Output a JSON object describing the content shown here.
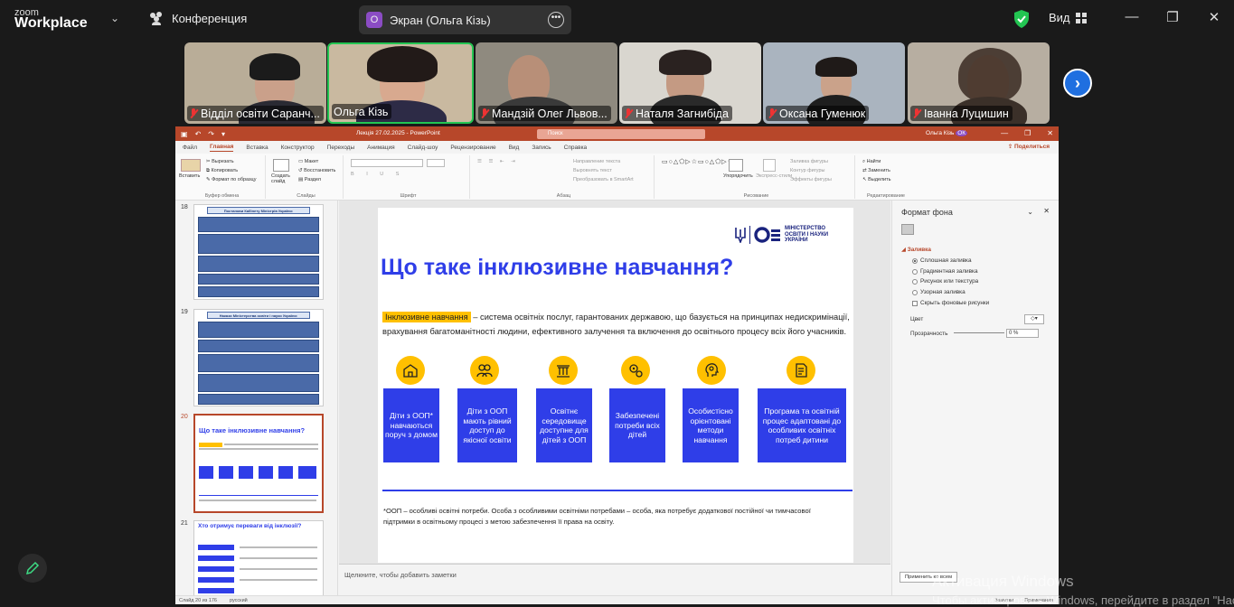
{
  "zoom": {
    "logo_line1": "zoom",
    "logo_line2": "Workplace",
    "conference_label": "Конференция",
    "share_initial": "О",
    "share_label": "Экран (Ольга Кізь)",
    "view_label": "Вид",
    "win_min": "—",
    "win_max": "❐",
    "win_close": "✕",
    "next_arrow": "›",
    "accent": "#1f6fe0",
    "security_color": "#23c552"
  },
  "participants": [
    {
      "name": "Відділ освіти Саранч...",
      "muted": true
    },
    {
      "name": "Ольга Кізь",
      "muted": false,
      "active": true
    },
    {
      "name": "Мандзій Олег Львов...",
      "muted": true
    },
    {
      "name": "Наталя Загнибіда",
      "muted": true
    },
    {
      "name": "Оксана Гуменюк",
      "muted": true
    },
    {
      "name": "Іванна Луцишин",
      "muted": true
    }
  ],
  "ppt": {
    "file_title": "Лекція 27.02.2025 - PowerPoint",
    "search_placeholder": "Поиск",
    "user_name": "Ольга Кізь",
    "user_initials": "ОК",
    "share_label": "Поделиться",
    "menu": [
      "Файл",
      "Главная",
      "Вставка",
      "Конструктор",
      "Переходы",
      "Анимация",
      "Слайд-шоу",
      "Рецензирование",
      "Вид",
      "Запись",
      "Справка"
    ],
    "ribbon": {
      "paste": "Вставить",
      "cut": "Вырезать",
      "copy": "Копировать",
      "format_painter": "Формат по образцу",
      "group_clipboard": "Буфер обмена",
      "new_slide": "Создать слайд",
      "layout": "Макет",
      "reset": "Восстановить",
      "section": "Раздел",
      "group_slides": "Слайды",
      "group_font": "Шрифт",
      "text_direction": "Направление текста",
      "align_text": "Выровнять текст",
      "smartart": "Преобразовать в SmartArt",
      "group_paragraph": "Абзац",
      "arrange": "Упорядочить",
      "quick_styles": "Экспресс-стили",
      "shape_fill": "Заливка фигуры",
      "shape_outline": "Контур фигуры",
      "shape_effects": "Эффекты фигуры",
      "group_drawing": "Рисование",
      "find": "Найти",
      "replace": "Заменить",
      "select": "Выделить",
      "group_editing": "Редактирование"
    },
    "thumbs": [
      {
        "num": "18",
        "header": "Постанови Кабінету Міністрів України:"
      },
      {
        "num": "19",
        "header": "Накази Міністерства освіти і науки України:"
      },
      {
        "num": "20",
        "header": "Що таке інклюзивне навчання?"
      },
      {
        "num": "21",
        "header": "Хто отримує переваги від інклюзії?"
      }
    ],
    "slide": {
      "logo_text": "МІНІСТЕРСТВО ОСВІТИ І НАУКИ УКРАЇНИ",
      "title": "Що таке інклюзивне навчання?",
      "term": "Інклюзивне навчання",
      "definition_rest": " – система освітніх послуг, гарантованих державою, що базується на принципах недискримінації, врахування багатоманітності людини, ефективного залучення та включення до освітнього процесу всіх його учасників.",
      "cards": [
        {
          "text": "Діти з ООП* навчаються поруч з домом",
          "icon": "school-icon"
        },
        {
          "text": "Діти з ООП мають рівний доступ до якісної освіти",
          "icon": "people-icon"
        },
        {
          "text": "Освітнє середовище доступне для дітей з ООП",
          "icon": "column-icon"
        },
        {
          "text": "Забезпечені потреби всіх дітей",
          "icon": "gears-icon"
        },
        {
          "text": "Особистісно орієнтовані методи навчання",
          "icon": "head-gear-icon"
        },
        {
          "text": "Програма та освітній процес адаптовані до особливих освітніх потреб дитини",
          "icon": "document-icon"
        }
      ],
      "accent": "#2f3ee8",
      "highlight": "#ffc000",
      "footnote": "*ООП – особливі освітні потреби. Особа з особливими освітніми потребами – особа, яка потребує додаткової постійної чи тимчасової підтримки в освітньому процесі з метою забезпечення її права на освіту."
    },
    "notes_placeholder": "Щелкните, чтобы добавить заметки",
    "format_pane": {
      "title": "Формат фона",
      "section": "Заливка",
      "options": [
        "Сплошная заливка",
        "Градиентная заливка",
        "Рисунок или текстура",
        "Узорная заливка"
      ],
      "hide_bg": "Скрыть фоновые рисунки",
      "color_label": "Цвет",
      "transparency_label": "Прозрачность",
      "transparency_value": "0 %",
      "apply_all": "Применить ко всем"
    },
    "status": {
      "slide_info": "Слайд 20 из 176",
      "language": "русский",
      "notes": "Заметки",
      "comments": "Примечания"
    }
  },
  "watermark": {
    "line1": "Активация Windows",
    "line2": "Чтобы активировать Windows, перейдите в раздел \"Настройки\"."
  }
}
